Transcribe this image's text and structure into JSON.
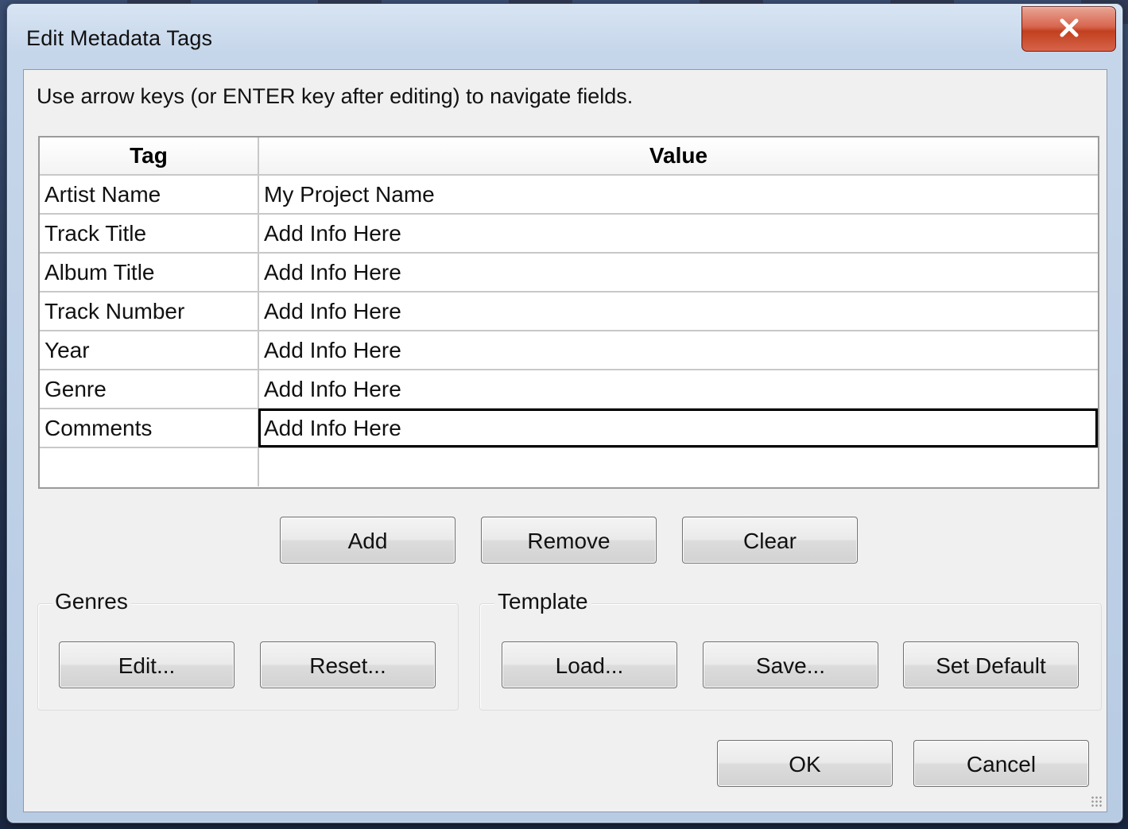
{
  "window": {
    "title": "Edit Metadata Tags",
    "close_icon": "close-icon"
  },
  "hint": "Use arrow keys (or ENTER key after editing) to navigate fields.",
  "table": {
    "columns": [
      "Tag",
      "Value"
    ],
    "rows": [
      {
        "tag": "Artist Name",
        "value": "My Project Name"
      },
      {
        "tag": "Track Title",
        "value": "Add Info Here"
      },
      {
        "tag": "Album Title",
        "value": "Add Info Here"
      },
      {
        "tag": "Track Number",
        "value": "Add Info Here"
      },
      {
        "tag": "Year",
        "value": "Add Info Here"
      },
      {
        "tag": "Genre",
        "value": "Add Info Here"
      },
      {
        "tag": "Comments",
        "value": "Add Info Here"
      }
    ],
    "selected_row": "Comments"
  },
  "row_buttons": {
    "add": "Add",
    "remove": "Remove",
    "clear": "Clear"
  },
  "genres": {
    "label": "Genres",
    "edit": "Edit...",
    "reset": "Reset..."
  },
  "template": {
    "label": "Template",
    "load": "Load...",
    "save": "Save...",
    "set_default": "Set Default"
  },
  "dialog_buttons": {
    "ok": "OK",
    "cancel": "Cancel"
  },
  "colors": {
    "close_button": "#c2401f",
    "client_bg": "#f0f0f0",
    "frame": "#b7cbe3"
  }
}
